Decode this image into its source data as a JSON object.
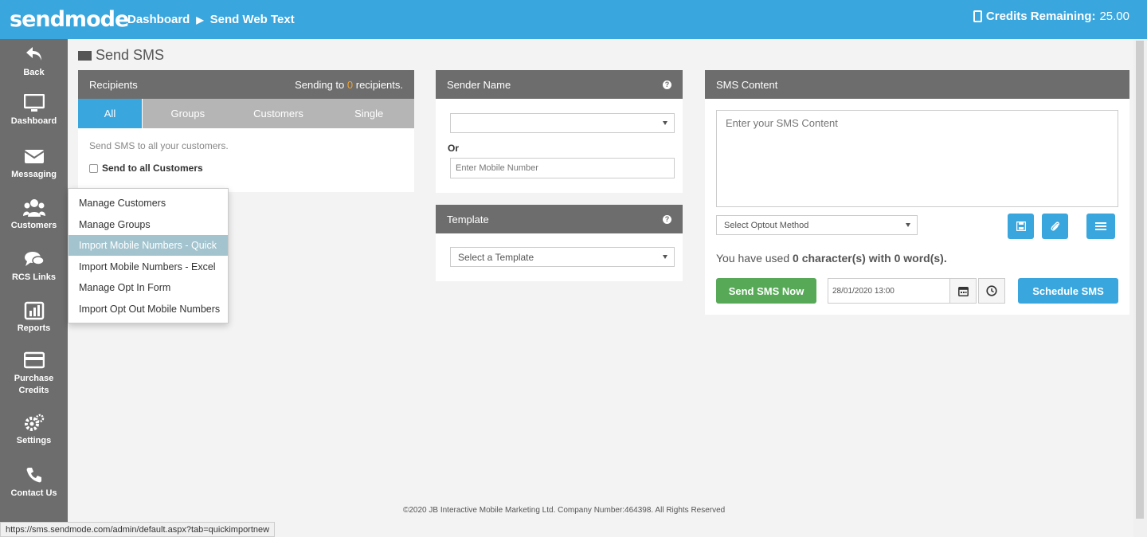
{
  "header": {
    "logo": "sendmode",
    "breadcrumb": [
      "Dashboard",
      "Send Web Text"
    ],
    "credits_label": "Credits Remaining:",
    "credits_value": "25.00"
  },
  "sidebar": {
    "items": [
      {
        "label": "Back",
        "icon": "back-arrow-icon"
      },
      {
        "label": "Dashboard",
        "icon": "monitor-icon"
      },
      {
        "label": "Messaging",
        "icon": "envelope-icon"
      },
      {
        "label": "Customers",
        "icon": "users-icon"
      },
      {
        "label": "RCS Links",
        "icon": "chat-bubbles-icon"
      },
      {
        "label": "Reports",
        "icon": "bar-chart-icon"
      },
      {
        "label": "Purchase",
        "label2": "Credits",
        "icon": "credit-card-icon"
      },
      {
        "label": "Settings",
        "icon": "gears-icon"
      },
      {
        "label": "Contact Us",
        "icon": "phone-icon"
      }
    ]
  },
  "page_title": "Send SMS",
  "recipients": {
    "title": "Recipients",
    "sending_prefix": "Sending to",
    "sending_count": "0",
    "sending_suffix": "recipients.",
    "tabs": [
      "All",
      "Groups",
      "Customers",
      "Single"
    ],
    "description": "Send SMS to all your customers.",
    "checkbox_label": "Send to all Customers"
  },
  "sender": {
    "title": "Sender Name",
    "or_label": "Or",
    "mobile_placeholder": "Enter Mobile Number"
  },
  "template": {
    "title": "Template",
    "select_value": "Select a Template"
  },
  "content": {
    "title": "SMS Content",
    "placeholder": "Enter your SMS Content",
    "optout_value": "Select Optout Method",
    "usage_prefix": "You have used",
    "usage_value": "0 character(s) with 0 word(s).",
    "send_now": "Send SMS Now",
    "datetime": "28/01/2020 13:00",
    "schedule": "Schedule SMS"
  },
  "menu": {
    "items": [
      "Manage Customers",
      "Manage Groups",
      "Import Mobile Numbers - Quick",
      "Import Mobile Numbers - Excel",
      "Manage Opt In Form",
      "Import Opt Out Mobile Numbers"
    ]
  },
  "footer": "©2020 JB Interactive Mobile Marketing Ltd. Company Number:464398. All Rights Reserved",
  "status_url": "https://sms.sendmode.com/admin/default.aspx?tab=quickimportnew",
  "colors": {
    "brand": "#3aa6de",
    "sidebar": "#6d6d6d",
    "send": "#57a957",
    "accent_count": "#f0a330"
  }
}
